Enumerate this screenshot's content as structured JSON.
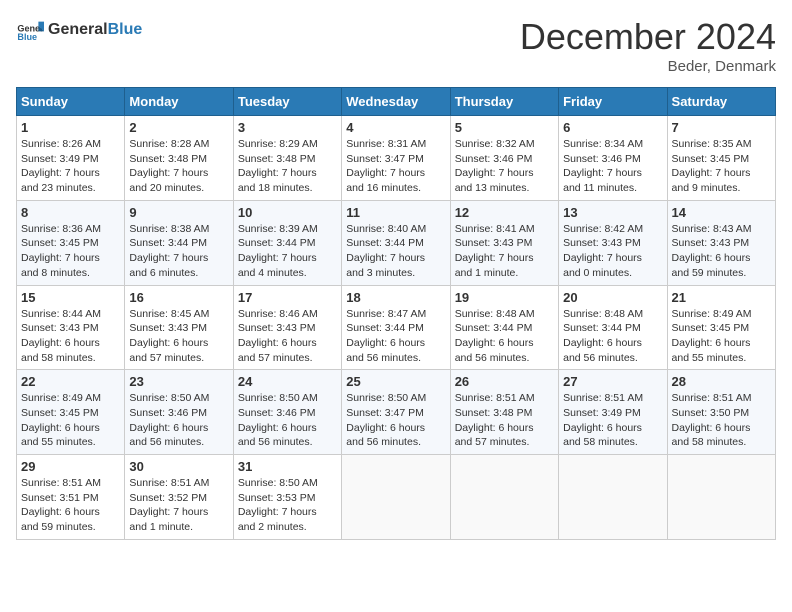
{
  "header": {
    "logo_general": "General",
    "logo_blue": "Blue",
    "month_year": "December 2024",
    "location": "Beder, Denmark"
  },
  "weekdays": [
    "Sunday",
    "Monday",
    "Tuesday",
    "Wednesday",
    "Thursday",
    "Friday",
    "Saturday"
  ],
  "weeks": [
    [
      {
        "day": "1",
        "lines": [
          "Sunrise: 8:26 AM",
          "Sunset: 3:49 PM",
          "Daylight: 7 hours",
          "and 23 minutes."
        ]
      },
      {
        "day": "2",
        "lines": [
          "Sunrise: 8:28 AM",
          "Sunset: 3:48 PM",
          "Daylight: 7 hours",
          "and 20 minutes."
        ]
      },
      {
        "day": "3",
        "lines": [
          "Sunrise: 8:29 AM",
          "Sunset: 3:48 PM",
          "Daylight: 7 hours",
          "and 18 minutes."
        ]
      },
      {
        "day": "4",
        "lines": [
          "Sunrise: 8:31 AM",
          "Sunset: 3:47 PM",
          "Daylight: 7 hours",
          "and 16 minutes."
        ]
      },
      {
        "day": "5",
        "lines": [
          "Sunrise: 8:32 AM",
          "Sunset: 3:46 PM",
          "Daylight: 7 hours",
          "and 13 minutes."
        ]
      },
      {
        "day": "6",
        "lines": [
          "Sunrise: 8:34 AM",
          "Sunset: 3:46 PM",
          "Daylight: 7 hours",
          "and 11 minutes."
        ]
      },
      {
        "day": "7",
        "lines": [
          "Sunrise: 8:35 AM",
          "Sunset: 3:45 PM",
          "Daylight: 7 hours",
          "and 9 minutes."
        ]
      }
    ],
    [
      {
        "day": "8",
        "lines": [
          "Sunrise: 8:36 AM",
          "Sunset: 3:45 PM",
          "Daylight: 7 hours",
          "and 8 minutes."
        ]
      },
      {
        "day": "9",
        "lines": [
          "Sunrise: 8:38 AM",
          "Sunset: 3:44 PM",
          "Daylight: 7 hours",
          "and 6 minutes."
        ]
      },
      {
        "day": "10",
        "lines": [
          "Sunrise: 8:39 AM",
          "Sunset: 3:44 PM",
          "Daylight: 7 hours",
          "and 4 minutes."
        ]
      },
      {
        "day": "11",
        "lines": [
          "Sunrise: 8:40 AM",
          "Sunset: 3:44 PM",
          "Daylight: 7 hours",
          "and 3 minutes."
        ]
      },
      {
        "day": "12",
        "lines": [
          "Sunrise: 8:41 AM",
          "Sunset: 3:43 PM",
          "Daylight: 7 hours",
          "and 1 minute."
        ]
      },
      {
        "day": "13",
        "lines": [
          "Sunrise: 8:42 AM",
          "Sunset: 3:43 PM",
          "Daylight: 7 hours",
          "and 0 minutes."
        ]
      },
      {
        "day": "14",
        "lines": [
          "Sunrise: 8:43 AM",
          "Sunset: 3:43 PM",
          "Daylight: 6 hours",
          "and 59 minutes."
        ]
      }
    ],
    [
      {
        "day": "15",
        "lines": [
          "Sunrise: 8:44 AM",
          "Sunset: 3:43 PM",
          "Daylight: 6 hours",
          "and 58 minutes."
        ]
      },
      {
        "day": "16",
        "lines": [
          "Sunrise: 8:45 AM",
          "Sunset: 3:43 PM",
          "Daylight: 6 hours",
          "and 57 minutes."
        ]
      },
      {
        "day": "17",
        "lines": [
          "Sunrise: 8:46 AM",
          "Sunset: 3:43 PM",
          "Daylight: 6 hours",
          "and 57 minutes."
        ]
      },
      {
        "day": "18",
        "lines": [
          "Sunrise: 8:47 AM",
          "Sunset: 3:44 PM",
          "Daylight: 6 hours",
          "and 56 minutes."
        ]
      },
      {
        "day": "19",
        "lines": [
          "Sunrise: 8:48 AM",
          "Sunset: 3:44 PM",
          "Daylight: 6 hours",
          "and 56 minutes."
        ]
      },
      {
        "day": "20",
        "lines": [
          "Sunrise: 8:48 AM",
          "Sunset: 3:44 PM",
          "Daylight: 6 hours",
          "and 56 minutes."
        ]
      },
      {
        "day": "21",
        "lines": [
          "Sunrise: 8:49 AM",
          "Sunset: 3:45 PM",
          "Daylight: 6 hours",
          "and 55 minutes."
        ]
      }
    ],
    [
      {
        "day": "22",
        "lines": [
          "Sunrise: 8:49 AM",
          "Sunset: 3:45 PM",
          "Daylight: 6 hours",
          "and 55 minutes."
        ]
      },
      {
        "day": "23",
        "lines": [
          "Sunrise: 8:50 AM",
          "Sunset: 3:46 PM",
          "Daylight: 6 hours",
          "and 56 minutes."
        ]
      },
      {
        "day": "24",
        "lines": [
          "Sunrise: 8:50 AM",
          "Sunset: 3:46 PM",
          "Daylight: 6 hours",
          "and 56 minutes."
        ]
      },
      {
        "day": "25",
        "lines": [
          "Sunrise: 8:50 AM",
          "Sunset: 3:47 PM",
          "Daylight: 6 hours",
          "and 56 minutes."
        ]
      },
      {
        "day": "26",
        "lines": [
          "Sunrise: 8:51 AM",
          "Sunset: 3:48 PM",
          "Daylight: 6 hours",
          "and 57 minutes."
        ]
      },
      {
        "day": "27",
        "lines": [
          "Sunrise: 8:51 AM",
          "Sunset: 3:49 PM",
          "Daylight: 6 hours",
          "and 58 minutes."
        ]
      },
      {
        "day": "28",
        "lines": [
          "Sunrise: 8:51 AM",
          "Sunset: 3:50 PM",
          "Daylight: 6 hours",
          "and 58 minutes."
        ]
      }
    ],
    [
      {
        "day": "29",
        "lines": [
          "Sunrise: 8:51 AM",
          "Sunset: 3:51 PM",
          "Daylight: 6 hours",
          "and 59 minutes."
        ]
      },
      {
        "day": "30",
        "lines": [
          "Sunrise: 8:51 AM",
          "Sunset: 3:52 PM",
          "Daylight: 7 hours",
          "and 1 minute."
        ]
      },
      {
        "day": "31",
        "lines": [
          "Sunrise: 8:50 AM",
          "Sunset: 3:53 PM",
          "Daylight: 7 hours",
          "and 2 minutes."
        ]
      },
      null,
      null,
      null,
      null
    ]
  ]
}
